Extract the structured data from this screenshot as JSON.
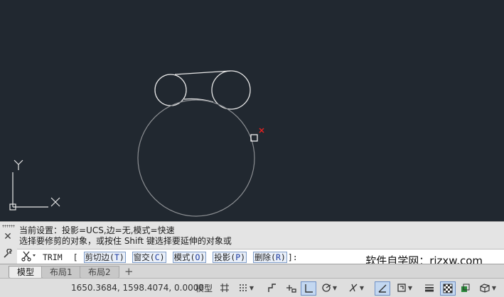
{
  "axis": {
    "x_label": "X",
    "y_label": "Y"
  },
  "command": {
    "history_line1": "当前设置：投影=UCS,边=无,模式=快速",
    "history_line2": "选择要修剪的对象，或按住 Shift 键选择要延伸的对象或",
    "name": "TRIM",
    "open_bracket": "[",
    "options": [
      {
        "label": "剪切边(",
        "key": "T",
        "end": ")"
      },
      {
        "label": "窗交(",
        "key": "C",
        "end": ")"
      },
      {
        "label": "模式(",
        "key": "O",
        "end": ")"
      },
      {
        "label": "投影(",
        "key": "P",
        "end": ")"
      },
      {
        "label": "删除(",
        "key": "R",
        "end": ")"
      }
    ],
    "close": "]:"
  },
  "watermark": "软件自学网：rjzxw.com",
  "tabs": [
    {
      "label": "模型",
      "active": true
    },
    {
      "label": "布局1",
      "active": false
    },
    {
      "label": "布局2",
      "active": false
    }
  ],
  "tab_add": "+",
  "status": {
    "coordinates": "1650.3684, 1598.4074, 0.0000",
    "model_label": "模型"
  },
  "icons": {
    "close": "✕",
    "wrench": "🔧",
    "trim": "✂"
  }
}
